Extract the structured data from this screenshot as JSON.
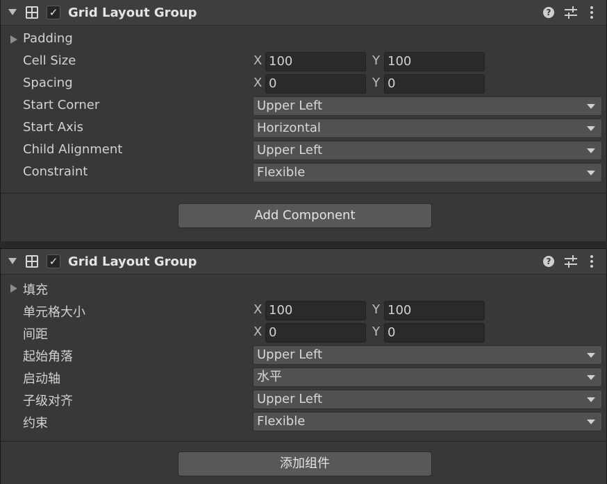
{
  "panels": [
    {
      "component_title": "Grid Layout Group",
      "enabled": "✓",
      "help_icon": "?",
      "padding_label": "Padding",
      "cell_size_label": "Cell Size",
      "cell_size_x": "100",
      "cell_size_y": "100",
      "spacing_label": "Spacing",
      "spacing_x": "0",
      "spacing_y": "0",
      "start_corner_label": "Start Corner",
      "start_corner_value": "Upper Left",
      "start_axis_label": "Start Axis",
      "start_axis_value": "Horizontal",
      "child_alignment_label": "Child Alignment",
      "child_alignment_value": "Upper Left",
      "constraint_label": "Constraint",
      "constraint_value": "Flexible",
      "add_component_label": "Add Component"
    },
    {
      "component_title": "Grid Layout Group",
      "enabled": "✓",
      "help_icon": "?",
      "padding_label": "填充",
      "cell_size_label": "单元格大小",
      "cell_size_x": "100",
      "cell_size_y": "100",
      "spacing_label": "间距",
      "spacing_x": "0",
      "spacing_y": "0",
      "start_corner_label": "起始角落",
      "start_corner_value": "Upper Left",
      "start_axis_label": "启动轴",
      "start_axis_value": "水平",
      "child_alignment_label": "子级对齐",
      "child_alignment_value": "Upper Left",
      "constraint_label": "约束",
      "constraint_value": "Flexible",
      "add_component_label": "添加组件"
    }
  ],
  "axis_labels": {
    "x": "X",
    "y": "Y"
  },
  "colors": {
    "panel_bg": "#383838",
    "header_bg": "#3e3e3e",
    "field_bg": "#2a2a2a",
    "dropdown_bg": "#515151",
    "button_bg": "#585858"
  },
  "icons": [
    "foldout-arrow-icon",
    "grid-layout-icon",
    "help-icon",
    "presets-icon",
    "kebab-menu-icon",
    "dropdown-arrow-icon"
  ]
}
